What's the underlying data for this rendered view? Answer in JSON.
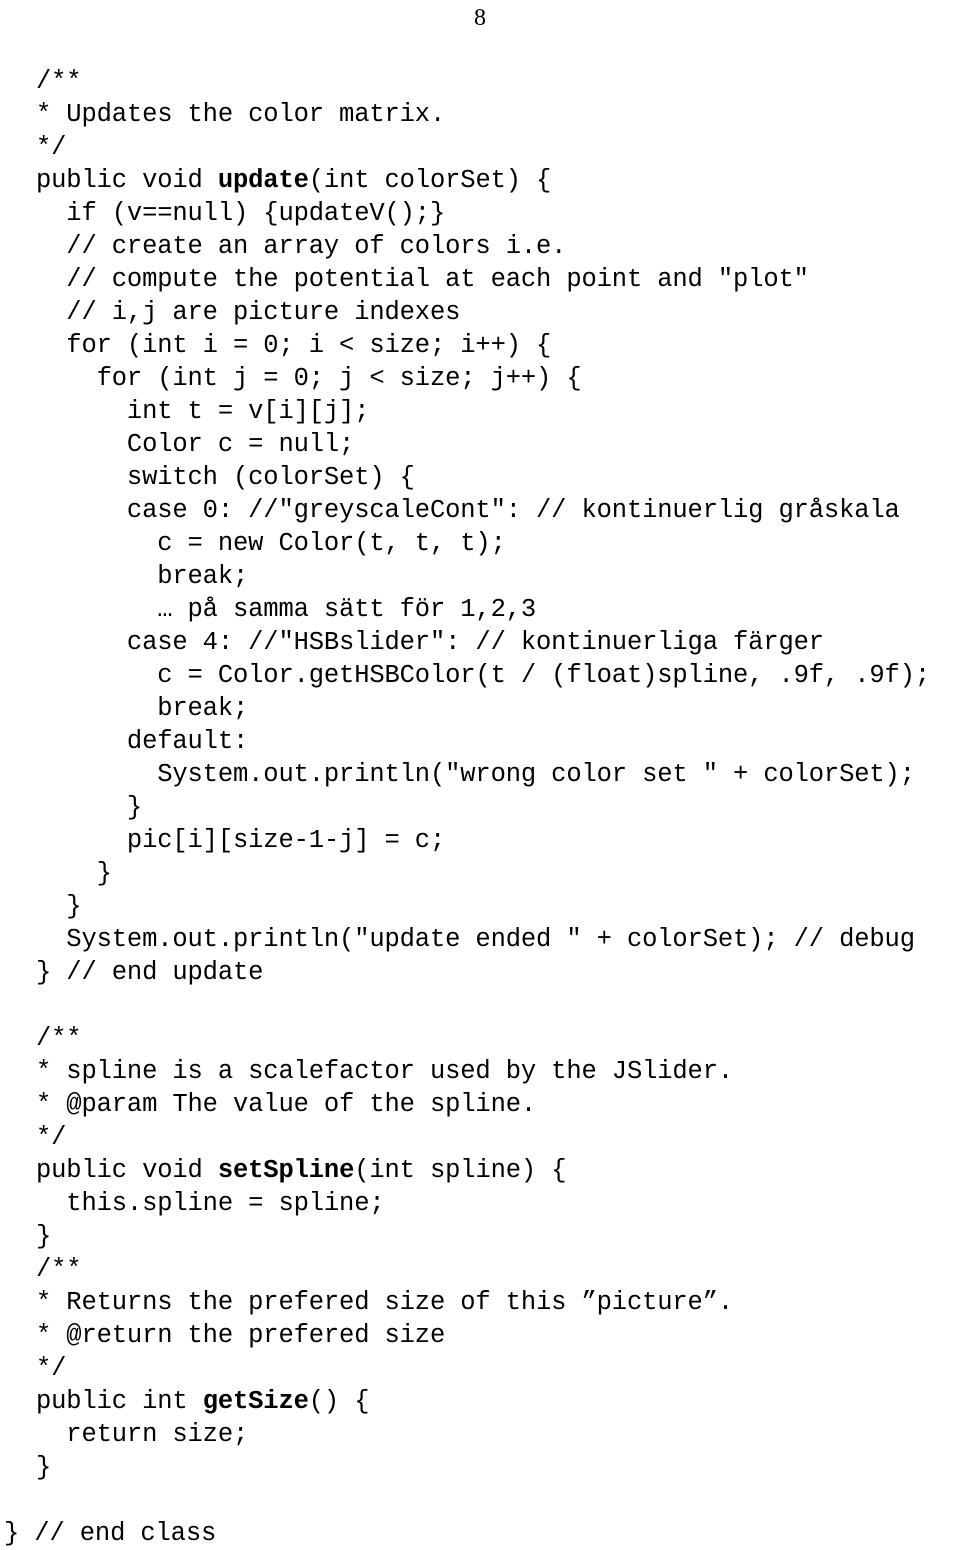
{
  "page": {
    "number": "8"
  },
  "code": {
    "lines": [
      {
        "indent": 0,
        "text": "/**"
      },
      {
        "indent": 0,
        "text": "* Updates the color matrix."
      },
      {
        "indent": 0,
        "text": "*/"
      },
      {
        "indent": 0,
        "pre": "public void ",
        "bold": "update",
        "post": "(int colorSet) {"
      },
      {
        "indent": 1,
        "text": "if (v==null) {updateV();}"
      },
      {
        "indent": 1,
        "text": "// create an array of colors i.e."
      },
      {
        "indent": 1,
        "text": "// compute the potential at each point and \"plot\""
      },
      {
        "indent": 1,
        "text": "// i,j are picture indexes"
      },
      {
        "indent": 1,
        "text": "for (int i = 0; i < size; i++) {"
      },
      {
        "indent": 2,
        "text": "for (int j = 0; j < size; j++) {"
      },
      {
        "indent": 3,
        "text": "int t = v[i][j];"
      },
      {
        "indent": 3,
        "text": "Color c = null;"
      },
      {
        "indent": 3,
        "text": "switch (colorSet) {"
      },
      {
        "indent": 3,
        "text": "case 0: //\"greyscaleCont\": // kontinuerlig gråskala"
      },
      {
        "indent": 4,
        "text": "c = new Color(t, t, t);"
      },
      {
        "indent": 4,
        "text": "break;"
      },
      {
        "indent": 4,
        "text": "… på samma sätt för 1,2,3"
      },
      {
        "indent": 3,
        "text": "case 4: //\"HSBslider\": // kontinuerliga färger"
      },
      {
        "indent": 4,
        "text": "c = Color.getHSBColor(t / (float)spline, .9f, .9f);"
      },
      {
        "indent": 4,
        "text": "break;"
      },
      {
        "indent": 3,
        "text": "default:"
      },
      {
        "indent": 4,
        "text": "System.out.println(\"wrong color set \" + colorSet);"
      },
      {
        "indent": 3,
        "text": "}"
      },
      {
        "indent": 3,
        "text": "pic[i][size-1-j] = c;"
      },
      {
        "indent": 2,
        "text": "}"
      },
      {
        "indent": 1,
        "text": "}"
      },
      {
        "indent": 1,
        "text": "System.out.println(\"update ended \" + colorSet); // debug"
      },
      {
        "indent": 0,
        "text": "} // end update"
      },
      {
        "indent": 0,
        "text": ""
      },
      {
        "indent": 0,
        "text": "/**"
      },
      {
        "indent": 0,
        "text": "* spline is a scalefactor used by the JSlider."
      },
      {
        "indent": 0,
        "text": "* @param The value of the spline."
      },
      {
        "indent": 0,
        "text": "*/"
      },
      {
        "indent": 0,
        "pre": "public void ",
        "bold": "setSpline",
        "post": "(int spline) {"
      },
      {
        "indent": 1,
        "text": "this.spline = spline;"
      },
      {
        "indent": 0,
        "text": "}"
      },
      {
        "indent": 0,
        "text": "/**"
      },
      {
        "indent": 0,
        "text": "* Returns the prefered size of this ”picture”."
      },
      {
        "indent": 0,
        "text": "* @return the prefered size"
      },
      {
        "indent": 0,
        "text": "*/"
      },
      {
        "indent": 0,
        "pre": "public int ",
        "bold": "getSize",
        "post": "() {"
      },
      {
        "indent": 1,
        "text": "return size;"
      },
      {
        "indent": 0,
        "text": "}"
      },
      {
        "indent": 0,
        "text": ""
      },
      {
        "indent": -1,
        "text": "} // end class"
      }
    ]
  }
}
